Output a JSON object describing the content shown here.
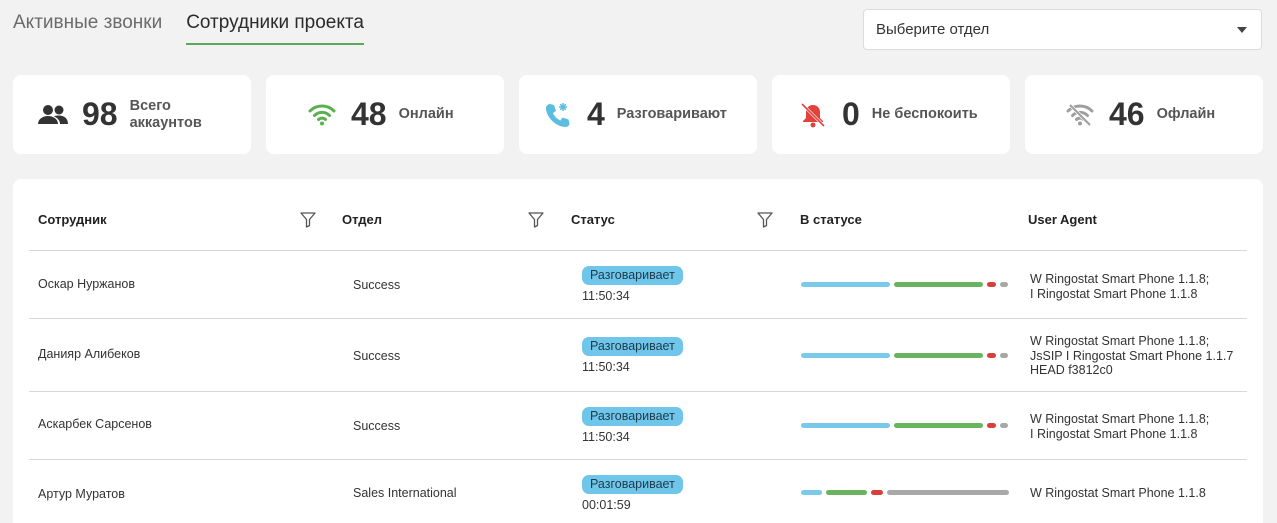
{
  "tabs": [
    {
      "label": "Активные звонки",
      "active": false
    },
    {
      "label": "Сотрудники проекта",
      "active": true
    }
  ],
  "department_select": {
    "placeholder": "Выберите отдел"
  },
  "stats": [
    {
      "icon": "people-icon",
      "value": "98",
      "label_line1": "Всего",
      "label_line2": "аккаунтов",
      "color": "#333333"
    },
    {
      "icon": "wifi-icon",
      "value": "48",
      "label_line1": "Онлайн",
      "label_line2": "",
      "color": "#5aaf4f"
    },
    {
      "icon": "phone-in-talk-icon",
      "value": "4",
      "label_line1": "Разговаривают",
      "label_line2": "",
      "color": "#5bbde0"
    },
    {
      "icon": "bell-off-icon",
      "value": "0",
      "label_line1": "Не беспокоить",
      "label_line2": "",
      "color": "#e2423b"
    },
    {
      "icon": "wifi-off-icon",
      "value": "46",
      "label_line1": "Офлайн",
      "label_line2": "",
      "color": "#9e9e9e"
    }
  ],
  "table": {
    "headers": {
      "employee": "Сотрудник",
      "department": "Отдел",
      "status": "Статус",
      "in_status": "В статусе",
      "user_agent": "User Agent"
    },
    "rows": [
      {
        "name": "Оскар Нуржанов",
        "department": "Success",
        "status": "Разговаривает",
        "time": "11:50:34",
        "status_bar": [
          0.43,
          0.43,
          0.045,
          0.04
        ],
        "ua_line1": "W Ringostat Smart Phone 1.1.8;",
        "ua_line2": "I Ringostat Smart Phone 1.1.8",
        "ua_line3": ""
      },
      {
        "name": "Данияр Алибеков",
        "department": "Success",
        "status": "Разговаривает",
        "time": "11:50:34",
        "status_bar": [
          0.43,
          0.43,
          0.045,
          0.04
        ],
        "ua_line1": "W Ringostat Smart Phone 1.1.8;",
        "ua_line2": "JsSIP I Ringostat Smart Phone 1.1.7",
        "ua_line3": "HEAD f3812c0"
      },
      {
        "name": "Аскарбек Сарсенов",
        "department": "Success",
        "status": "Разговаривает",
        "time": "11:50:34",
        "status_bar": [
          0.43,
          0.43,
          0.045,
          0.04
        ],
        "ua_line1": "W Ringostat Smart Phone 1.1.8;",
        "ua_line2": "I Ringostat Smart Phone 1.1.8",
        "ua_line3": ""
      },
      {
        "name": "Артур Муратов",
        "department": "Sales International",
        "status": "Разговаривает",
        "time": "00:01:59",
        "status_bar": [
          0.1,
          0.2,
          0.06,
          0.59
        ],
        "ua_line1": "W Ringostat Smart Phone 1.1.8",
        "ua_line2": "",
        "ua_line3": ""
      }
    ]
  },
  "colors": {
    "accent": "#5aa85a",
    "badge": "#6fc6ea",
    "bar_blue": "#79c9ea",
    "bar_green": "#6ab35f",
    "bar_red": "#d8403a",
    "bar_gray": "#a8a8a8"
  }
}
